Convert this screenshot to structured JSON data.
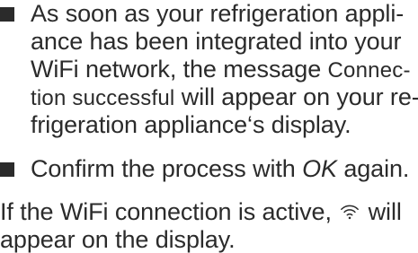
{
  "item1": {
    "line1": "As soon as your refrigeration appli-",
    "line2": "ance has been integrated into your",
    "line3": "WiFi network, the message ",
    "display_msg_part1": "Connec-",
    "display_msg_part2": "tion successful",
    "line4_rest": " will appear on your re-",
    "line5": "frigeration appliance‘s display."
  },
  "item2": {
    "prefix": "Confirm the process with ",
    "ok": "OK",
    "suffix": " again."
  },
  "para": {
    "prefix": "If the WiFi connection is active, ",
    "icon": "wifi-icon",
    "suffix": " will",
    "line2": "appear on the display."
  }
}
